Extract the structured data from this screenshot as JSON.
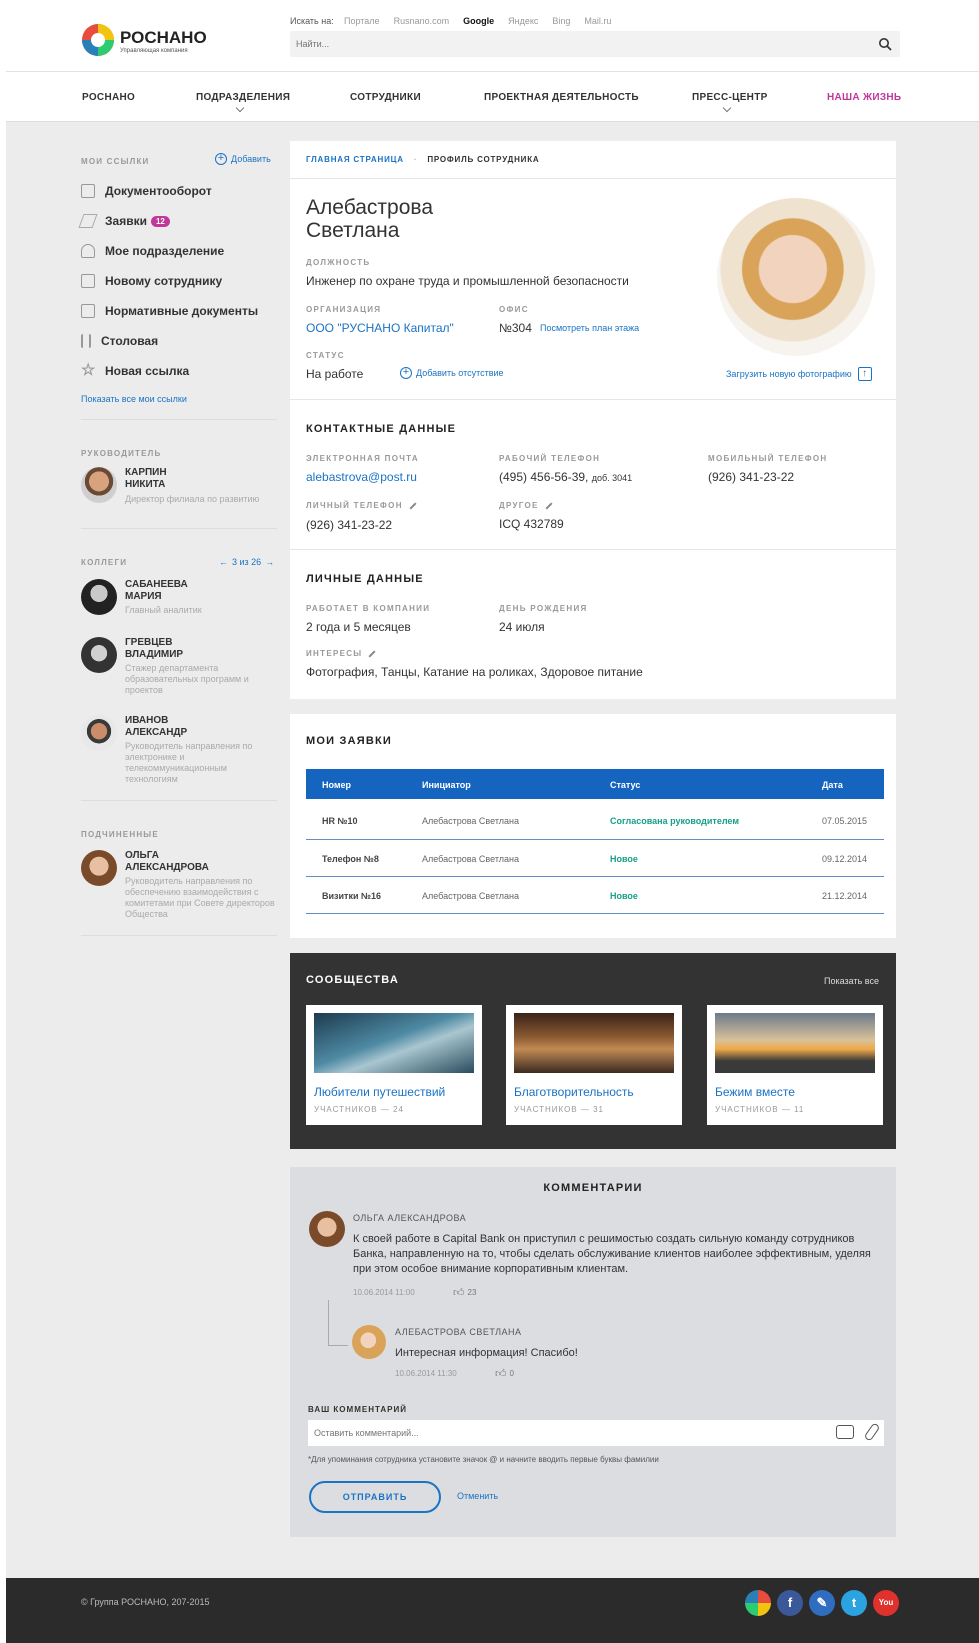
{
  "header": {
    "logo_title": "РОСНАНО",
    "logo_subtitle": "Управляющая компания",
    "search_in_label": "Искать на:",
    "search_engines": [
      "Портале",
      "Rusnano.com",
      "Google",
      "Яндекс",
      "Bing",
      "Mail.ru"
    ],
    "search_active": "Google",
    "search_placeholder": "Найти..."
  },
  "nav": {
    "items": [
      "РОСНАНО",
      "ПОДРАЗДЕЛЕНИЯ",
      "СОТРУДНИКИ",
      "ПРОЕКТНАЯ ДЕЯТЕЛЬНОСТЬ",
      "ПРЕСС-ЦЕНТР",
      "НАША ЖИЗНЬ"
    ],
    "accent": "#c0399a"
  },
  "sidebar": {
    "links_title": "МОИ ССЫЛКИ",
    "add_label": "Добавить",
    "links": [
      {
        "label": "Документооборот",
        "icon": "briefcase-icon"
      },
      {
        "label": "Заявки",
        "icon": "paper-plane-icon",
        "badge": "12"
      },
      {
        "label": "Мое подразделение",
        "icon": "users-icon"
      },
      {
        "label": "Новому сотруднику",
        "icon": "clipboard-icon"
      },
      {
        "label": "Нормативные документы",
        "icon": "document-icon"
      },
      {
        "label": "Столовая",
        "icon": "fork-knife-icon"
      },
      {
        "label": "Новая ссылка",
        "icon": "star-icon"
      }
    ],
    "show_all_links": "Показать все мои ссылки",
    "manager_title": "РУКОВОДИТЕЛЬ",
    "manager": {
      "name1": "КАРПИН",
      "name2": "НИКИТА",
      "role": "Директор филиала по развитию"
    },
    "colleagues_title": "КОЛЛЕГИ",
    "colleagues_pager": "3 из 26",
    "colleagues": [
      {
        "name1": "САБАНЕЕВА",
        "name2": "МАРИЯ",
        "role": "Главный аналитик"
      },
      {
        "name1": "ГРЕВЦЕВ",
        "name2": "ВЛАДИМИР",
        "role": "Стажер департамента образовательных программ и проектов"
      },
      {
        "name1": "ИВАНОВ",
        "name2": "АЛЕКСАНДР",
        "role": "Руководитель направления по электронике и телекоммуникационным технологиям"
      }
    ],
    "subordinates_title": "ПОДЧИНЕННЫЕ",
    "subordinate": {
      "name1": "ОЛЬГА",
      "name2": "АЛЕКСАНДРОВА",
      "role": "Руководитель направления по обеспечению взаимодействия с комитетами при Совете директоров Общества"
    }
  },
  "profile": {
    "breadcrumb_home": "ГЛАВНАЯ СТРАНИЦА",
    "breadcrumb_current": "ПРОФИЛЬ СОТРУДНИКА",
    "last_name": "Алебастрова",
    "first_name": "Светлана",
    "position_label": "ДОЛЖНОСТЬ",
    "position": "Инженер по охране труда и промышленной безопасности",
    "org_label": "ОРГАНИЗАЦИЯ",
    "org": "ООО \"РУСНАНО Капитал\"",
    "office_label": "ОФИС",
    "office": "№304",
    "floor_plan_link": "Посмотреть план этажа",
    "status_label": "СТАТУС",
    "status": "На работе",
    "add_absence": "Добавить отсутствие",
    "upload_photo": "Загрузить новую фотографию"
  },
  "contacts": {
    "title": "КОНТАКТНЫЕ ДАННЫЕ",
    "email_label": "ЭЛЕКТРОННАЯ ПОЧТА",
    "email": "alebastrova@post.ru",
    "work_phone_label": "РАБОЧИЙ ТЕЛЕФОН",
    "work_phone": "(495) 456-56-39,",
    "work_ext": "доб. 3041",
    "mobile_label": "МОБИЛЬНЫЙ ТЕЛЕФОН",
    "mobile": "(926) 341-23-22",
    "personal_phone_label": "ЛИЧНЫЙ ТЕЛЕФОН",
    "personal_phone": "(926) 341-23-22",
    "other_label": "ДРУГОЕ",
    "other": "ICQ 432789"
  },
  "personal": {
    "title": "ЛИЧНЫЕ ДАННЫЕ",
    "tenure_label": "РАБОТАЕТ В КОМПАНИИ",
    "tenure": "2 года и 5 месяцев",
    "birthday_label": "ДЕНЬ РОЖДЕНИЯ",
    "birthday": "24 июля",
    "interests_label": "ИНТЕРЕСЫ",
    "interests": "Фотография, Танцы, Катание на роликах, Здоровое питание"
  },
  "requests": {
    "title": "МОИ ЗАЯВКИ",
    "columns": [
      "Номер",
      "Инициатор",
      "Статус",
      "Дата"
    ],
    "rows": [
      [
        "HR №10",
        "Алебастрова Светлана",
        "Согласована руководителем",
        "07.05.2015"
      ],
      [
        "Телефон №8",
        "Алебастрова Светлана",
        "Новое",
        "09.12.2014"
      ],
      [
        "Визитки №16",
        "Алебастрова Светлана",
        "Новое",
        "21.12.2014"
      ]
    ],
    "header_color": "#1565c0"
  },
  "communities": {
    "title": "СООБЩЕСТВА",
    "show_all": "Показать все",
    "items": [
      {
        "title": "Любители путешествий",
        "count": "УЧАСТНИКОВ — 24"
      },
      {
        "title": "Благотворительность",
        "count": "УЧАСТНИКОВ — 31"
      },
      {
        "title": "Бежим вместе",
        "count": "УЧАСТНИКОВ — 11"
      }
    ]
  },
  "comments": {
    "title": "КОММЕНТАРИИ",
    "items": [
      {
        "author": "ОЛЬГА АЛЕКСАНДРОВА",
        "text": "К своей работе в Capital Bank он приступил с решимостью создать сильную команду сотрудников Банка, направленную на то, чтобы сделать обслуживание клиентов наиболее эффективным, уделяя при этом особое внимание корпоративным клиентам.",
        "date": "10.06.2014 11:00",
        "likes": "23"
      },
      {
        "author": "АЛЕБАСТРОВА СВЕТЛАНА",
        "text": "Интересная информация! Спасибо!",
        "date": "10.06.2014 11:30",
        "likes": "0"
      }
    ],
    "your_comment_label": "ВАШ КОММЕНТАРИЙ",
    "placeholder": "Оставить комментарий...",
    "hint": "*Для упоминания сотрудника установите значок @ и начните вводить первые буквы фамилии",
    "submit": "ОТПРАВИТЬ",
    "cancel": "Отменить"
  },
  "footer": {
    "copyright": "© Группа РОСНАНО, 207-2015"
  }
}
